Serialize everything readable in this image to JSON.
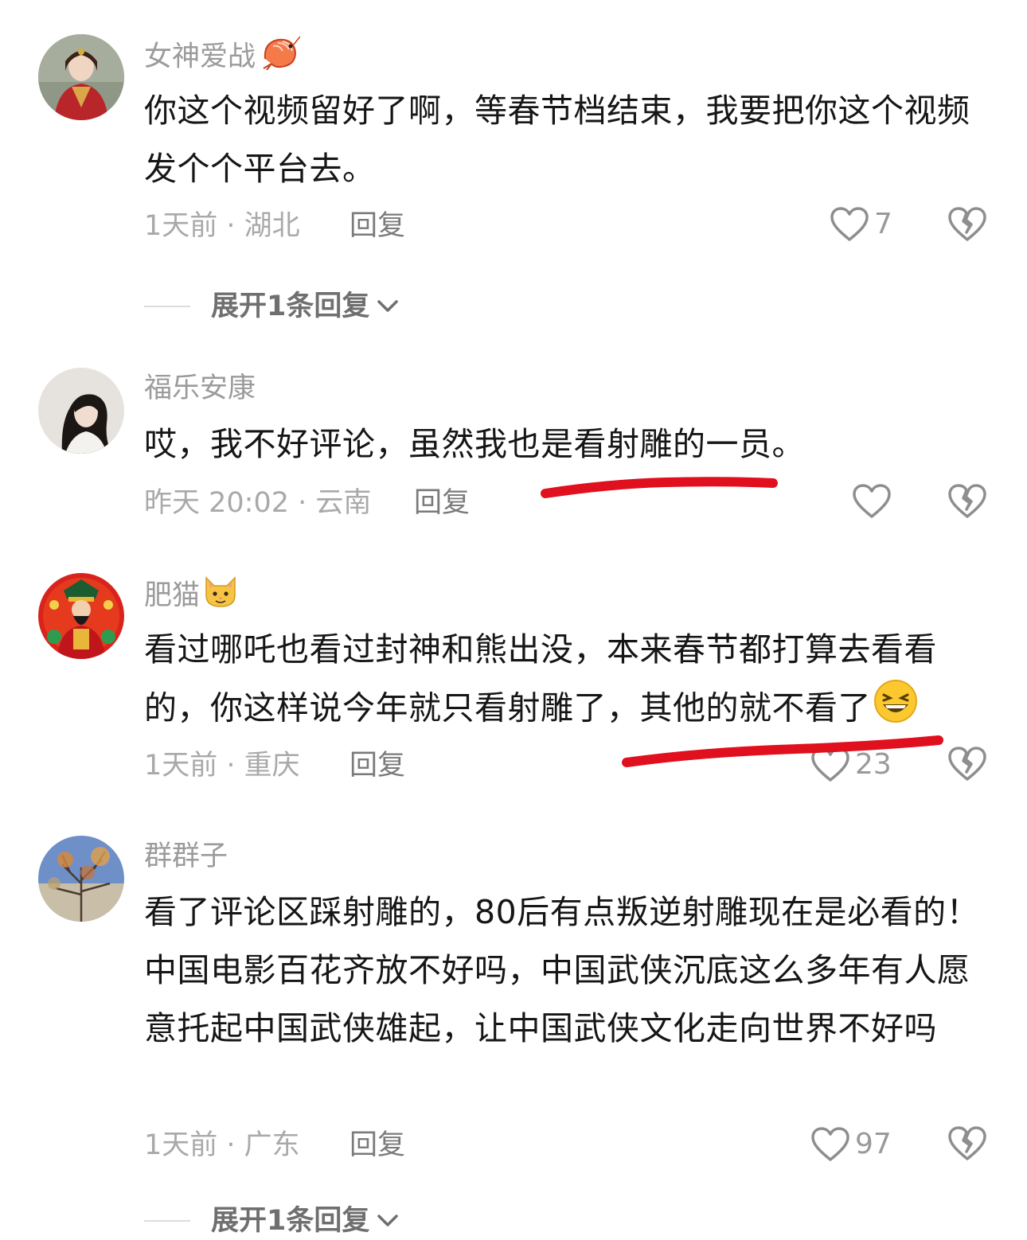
{
  "colors": {
    "username": "#9b9b9b",
    "text": "#161616",
    "meta": "#a9a9a9",
    "reply": "#7a7a7a",
    "annotation": "#e0101e"
  },
  "comments": [
    {
      "username": "女神爱战",
      "username_emoji": "shrimp-emoji",
      "text": "你这个视频留好了啊，等春节档结束，我要把你这个视频发个个平台去。",
      "meta": "1天前 · 湖北",
      "reply_label": "回复",
      "likes": "7"
    },
    {
      "username": "福乐安康",
      "text": "哎，我不好评论，虽然我也是看射雕的一员。",
      "meta": "昨天 20:02 · 云南",
      "reply_label": "回复",
      "likes": ""
    },
    {
      "username": "肥猫",
      "username_emoji": "cat-face-emoji",
      "text": "看过哪吒也看过封神和熊出没，本来春节都打算去看看的，你这样说今年就只看射雕了，其他的就不看了",
      "text_emoji": "grinning-squint-emoji",
      "meta": "1天前 · 重庆",
      "reply_label": "回复",
      "likes": "23"
    },
    {
      "username": "群群子",
      "text": "看了评论区踩射雕的，80后有点叛逆射雕现在是必看的！中国电影百花齐放不好吗，中国武侠沉底这么多年有人愿意托起中国武侠雄起，让中国武侠文化走向世界不好吗",
      "meta": "1天前 · 广东",
      "reply_label": "回复",
      "likes": "97"
    }
  ],
  "expand_replies": [
    {
      "label": "展开1条回复"
    },
    {
      "label": "展开1条回复"
    }
  ]
}
